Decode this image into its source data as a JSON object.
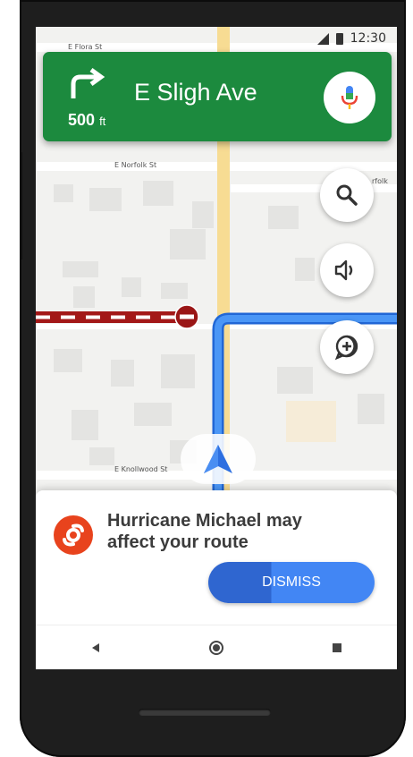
{
  "status_bar": {
    "time": "12:30"
  },
  "map": {
    "street_labels": {
      "flora": "E Flora St",
      "norfolk": "E Norfolk St",
      "norfolk_right": "rfolk",
      "knollwood": "E Knollwood St"
    }
  },
  "navigation": {
    "street": "E Sligh Ave",
    "distance_value": "500",
    "distance_unit": "ft",
    "maneuver_icon": "turn-right-arrow",
    "color": "#1c8a3e"
  },
  "controls": {
    "icons": [
      "mic-icon",
      "search-icon",
      "volume-icon",
      "add-report-icon"
    ]
  },
  "alert": {
    "message_line1": "Hurricane Michael may",
    "message_line2": "affect your route",
    "dismiss_label": "DISMISS",
    "icon": "hurricane-icon",
    "accent": "#e8431d",
    "button_color": "#4286f4"
  },
  "system_nav": {
    "icons": [
      "back-icon",
      "home-icon",
      "recents-icon"
    ]
  }
}
